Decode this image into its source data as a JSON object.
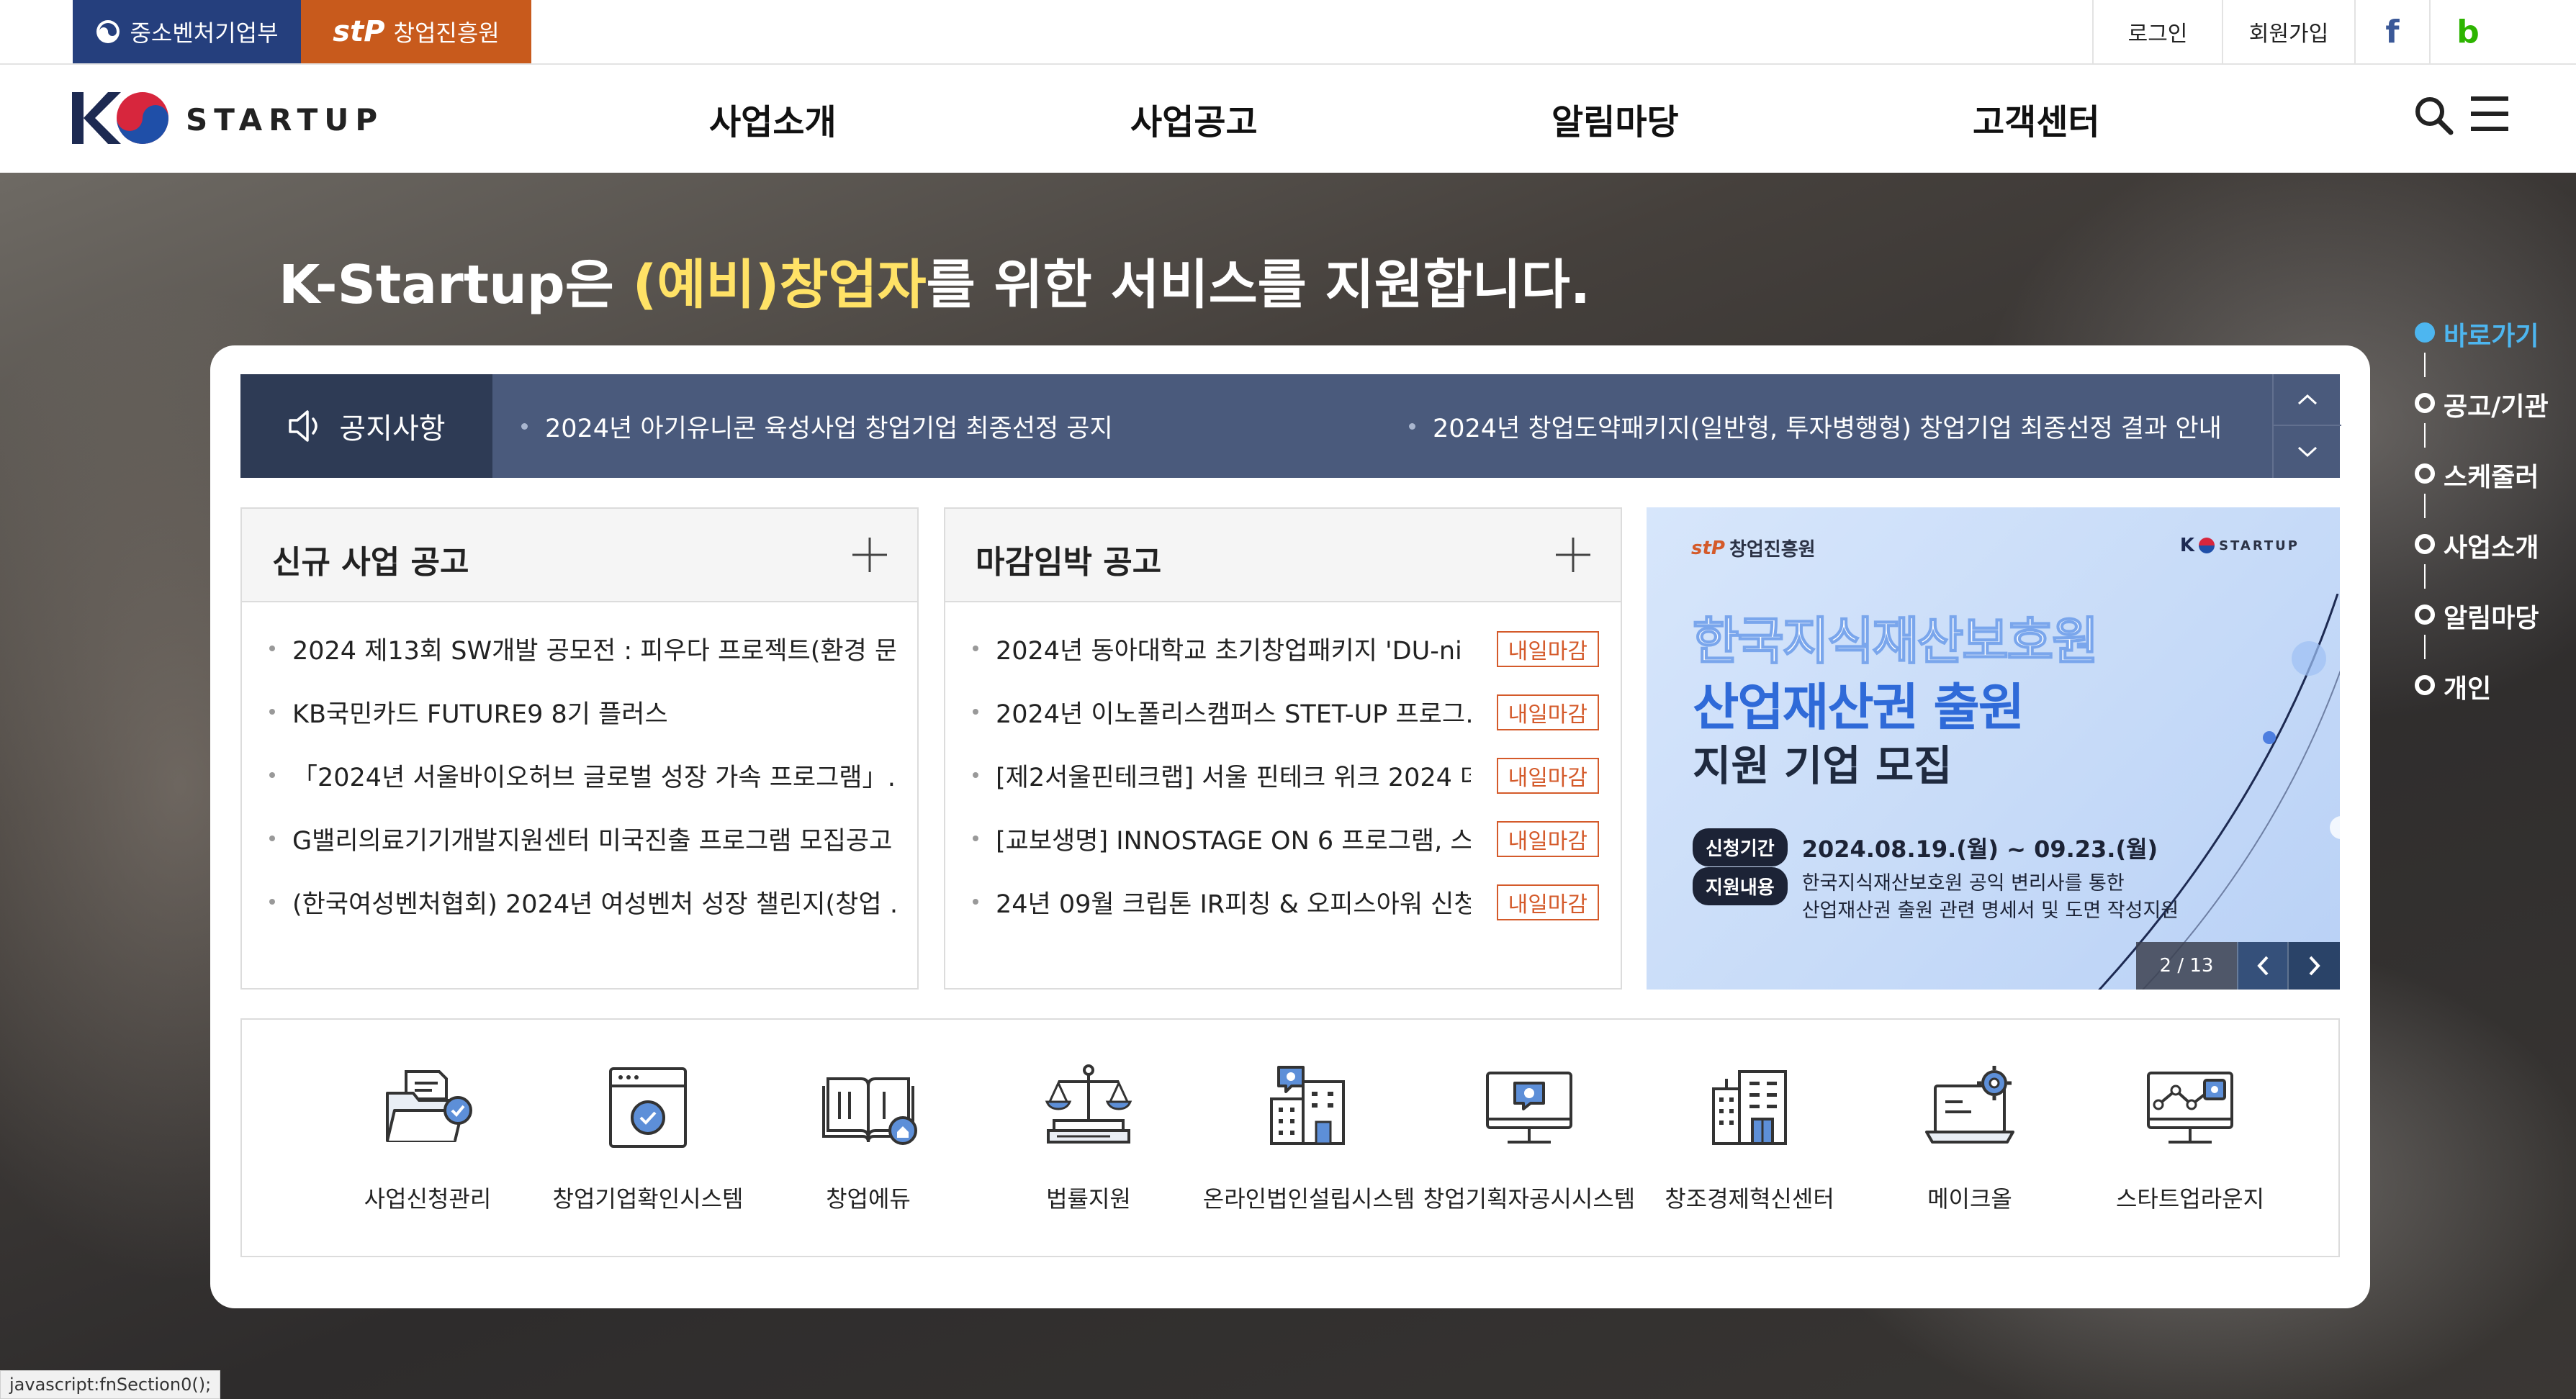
{
  "topbar": {
    "org1": "중소벤처기업부",
    "org2": "창업진흥원",
    "org2_logo": "stP",
    "login": "로그인",
    "signup": "회원가입",
    "facebook": "f",
    "blog": "b"
  },
  "header": {
    "logo_text": "STARTUP",
    "nav": [
      "사업소개",
      "사업공고",
      "알림마당",
      "고객센터"
    ]
  },
  "hero": {
    "headline_pre": "K-Startup은 ",
    "headline_highlight": "(예비)창업자",
    "headline_post": "를 위한 서비스를 지원합니다."
  },
  "notice": {
    "label": "공지사항",
    "items": [
      "2024년 아기유니콘 육성사업 창업기업 최종선정 공지",
      "2024년 창업도약패키지(일반형, 투자병행형) 창업기업 최종선정 결과 안내"
    ]
  },
  "new_biz": {
    "title": "신규 사업 공고",
    "items": [
      "2024 제13회 SW개발 공모전 : 피우다 프로젝트(환경 문…",
      "KB국민카드 FUTURE9 8기 플러스",
      "「2024년 서울바이오허브 글로벌 성장 가속 프로그램」…",
      "G밸리의료기기개발지원센터 미국진출 프로그램 모집공고",
      "(한국여성벤처협회) 2024년 여성벤처 성장 챌린지(창업 …"
    ]
  },
  "deadline_biz": {
    "title": "마감임박 공고",
    "badge": "내일마감",
    "items": [
      "2024년 동아대학교 초기창업패키지 'DU-ni …",
      "2024년 이노폴리스캠퍼스 STET-UP 프로그…",
      "[제2서울핀테크랩] 서울 핀테크 위크 2024 데…",
      "[교보생명] INNOSTAGE ON 6 프로그램, 스…",
      "24년 09월 크립톤 IR피칭 & 오피스아워 신청 …"
    ]
  },
  "banner": {
    "logo_left": "창업진흥원",
    "logo_right": "STARTUP",
    "line1": "한국지식재산보호원",
    "line2": "산업재산권 출원",
    "line3": "지원 기업 모집",
    "period_label": "신청기간",
    "period_value": "2024.08.19.(월) ~ 09.23.(월)",
    "content_label": "지원내용",
    "content_line1": "한국지식재산보호원 공익 변리사를 통한",
    "content_line2": "산업재산권 출원 관련 명세서 및 도면 작성지원",
    "pager": "2 / 13"
  },
  "quick_links": [
    {
      "label": "사업신청관리",
      "icon": "folder-check-icon"
    },
    {
      "label": "창업기업확인시스템",
      "icon": "window-check-icon"
    },
    {
      "label": "창업에듀",
      "icon": "book-home-icon"
    },
    {
      "label": "법률지원",
      "icon": "scale-books-icon"
    },
    {
      "label": "온라인법인설립시스템",
      "icon": "building-chat-icon"
    },
    {
      "label": "창업기획자공시시스템",
      "icon": "monitor-chat-icon"
    },
    {
      "label": "창조경제혁신센터",
      "icon": "office-building-icon"
    },
    {
      "label": "메이크올",
      "icon": "laptop-gear-icon"
    },
    {
      "label": "스타트업라운지",
      "icon": "monitor-network-icon"
    }
  ],
  "side_nav": {
    "items": [
      "바로가기",
      "공고/기관",
      "스케줄러",
      "사업소개",
      "알림마당",
      "개인"
    ],
    "active_color": "#4db6f0"
  },
  "status_bar": "javascript:fnSection0();",
  "colors": {
    "gov_blue": "#253f7d",
    "kised_orange": "#c85a1c",
    "notice_bg": "#4a5a7c",
    "deadline_red": "#d45a2a",
    "highlight_yellow": "#ffe266"
  }
}
